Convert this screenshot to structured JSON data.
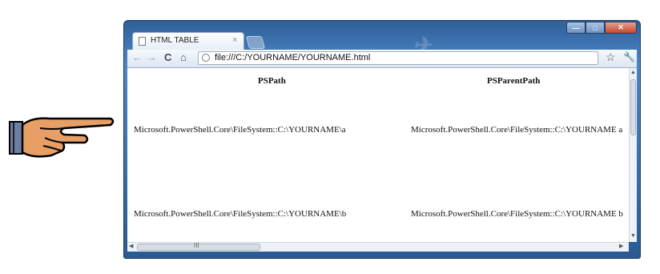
{
  "tab": {
    "title": "HTML TABLE",
    "close_glyph": "×",
    "new_tab_glyph": "+"
  },
  "window_buttons": {
    "minimize": "—",
    "maximize": "□",
    "close": "✕"
  },
  "toolbar": {
    "back_icon": "←",
    "forward_icon": "→",
    "reload_icon": "C",
    "home_icon": "⌂",
    "url": "file:///C:/YOURNAME/YOURNAME.html",
    "star_icon": "☆",
    "wrench_icon": "🔧"
  },
  "table": {
    "headers": [
      "PSPath",
      "PSParentPath"
    ],
    "rows": [
      [
        "Microsoft.PowerShell.Core\\FileSystem::C:\\YOURNAME\\a",
        "Microsoft.PowerShell.Core\\FileSystem::C:\\YOURNAME a"
      ],
      [
        "Microsoft.PowerShell.Core\\FileSystem::C:\\YOURNAME\\b",
        "Microsoft.PowerShell.Core\\FileSystem::C:\\YOURNAME b"
      ]
    ]
  },
  "scrollbar": {
    "grip": "III"
  },
  "colors": {
    "frame": "#2f5f96",
    "page": "#ffffff"
  }
}
